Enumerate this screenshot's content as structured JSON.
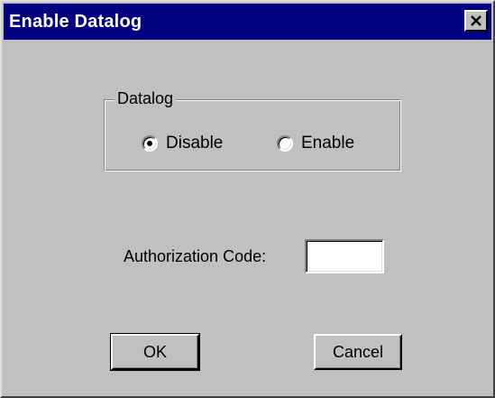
{
  "window": {
    "title": "Enable Datalog",
    "close_icon": "close-icon"
  },
  "datalog_group": {
    "label": "Datalog",
    "options": [
      {
        "label": "Disable",
        "selected": true
      },
      {
        "label": "Enable",
        "selected": false
      }
    ]
  },
  "authorization": {
    "label": "Authorization Code:",
    "value": ""
  },
  "buttons": {
    "ok_label": "OK",
    "cancel_label": "Cancel"
  },
  "colors": {
    "title_bar": "#000080",
    "face": "#c0c0c0"
  }
}
